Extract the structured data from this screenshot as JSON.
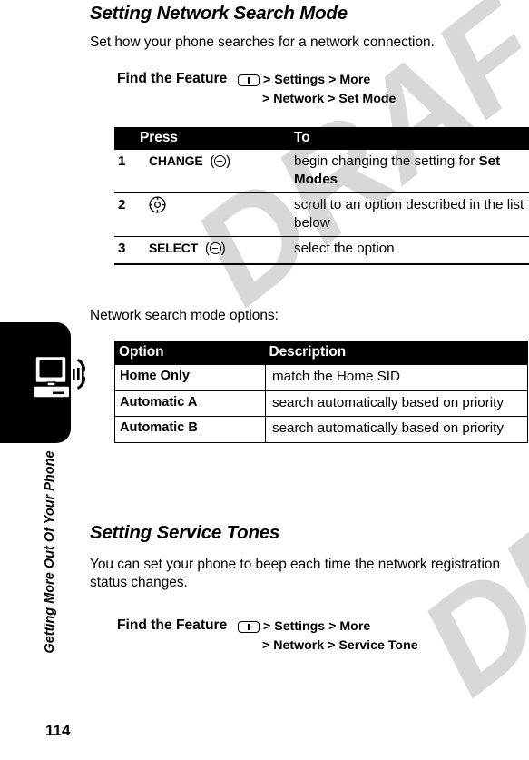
{
  "chapter": {
    "tab_title": "Getting More Out Of Your Phone",
    "page_number": "114",
    "icon": "computer-phone-icon"
  },
  "watermark": {
    "text": "DRAFT"
  },
  "sections": [
    {
      "heading": "Setting Network Search Mode",
      "intro": "Set how your phone searches for a network connection.",
      "find_feature": {
        "label": "Find the Feature",
        "key_icon": "menu-key-icon",
        "line1": "> Settings > More",
        "line2": "> Network > Set Mode",
        "path_items_line1": [
          "Settings",
          "More"
        ],
        "path_items_line2": [
          "Network",
          "Set Mode"
        ]
      }
    },
    {
      "heading": "Setting Service Tones",
      "intro": "You can set your phone to beep each time the network registration status changes.",
      "find_feature": {
        "label": "Find the Feature",
        "key_icon": "menu-key-icon",
        "line1": "> Settings > More",
        "line2": "> Network > Service Tone",
        "path_items_line1": [
          "Settings",
          "More"
        ],
        "path_items_line2": [
          "Network",
          "Service Tone"
        ]
      }
    }
  ],
  "steps_table": {
    "headers": {
      "num": "",
      "press": "Press",
      "to": "To"
    },
    "rows": [
      {
        "num": "1",
        "press_key": "CHANGE",
        "press_glyph": "soft-key-icon",
        "to_text": "begin changing the setting for ",
        "to_bold": "Set Modes"
      },
      {
        "num": "2",
        "press_key": "",
        "press_glyph": "navigation-key-icon",
        "to_text": "scroll to an option described in the list below",
        "to_bold": ""
      },
      {
        "num": "3",
        "press_key": "SELECT",
        "press_glyph": "soft-key-icon",
        "to_text": "select the option",
        "to_bold": ""
      }
    ]
  },
  "options_intro": "Network search mode options:",
  "options_table": {
    "headers": {
      "option": "Option",
      "description": "Description"
    },
    "rows": [
      {
        "option": "Home Only",
        "description": "match the Home SID"
      },
      {
        "option": "Automatic A",
        "description": "search automatically based on priority"
      },
      {
        "option": "Automatic B",
        "description": "search automatically based on priority"
      }
    ]
  }
}
